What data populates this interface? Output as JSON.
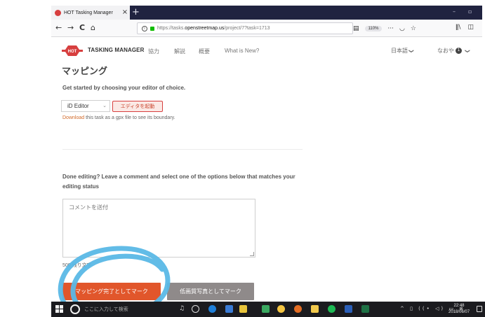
{
  "browser": {
    "tab_title": "HOT Tasking Manager",
    "tab_close": "×",
    "new_tab": "+",
    "window_minimize": "–",
    "window_restore": "▫",
    "back": "←",
    "forward": "→",
    "reload": "C",
    "home": "⌂",
    "url_prefix": "https://tasks.",
    "url_host": "openstreetmap.us",
    "url_path": "/project/7?task=1713",
    "zoom": "110%",
    "more": "···",
    "library_icon": "ǁ\\",
    "sidebar_icon": "◫"
  },
  "header": {
    "logo_badge": "HOT",
    "logo_text": "TASKING MANAGER",
    "nav": [
      "協力",
      "解説",
      "概要",
      "What is New?"
    ],
    "language": "日本語",
    "user": "なおや",
    "notifications": "1",
    "caret": "❯"
  },
  "main": {
    "section_title": "マッピング",
    "get_started": "Get started by choosing your editor of choice.",
    "editor_selected": "iD Editor",
    "editor_caret": "⌄",
    "launch_editor": "エディタを起動",
    "download_link": "Download",
    "download_rest": " this task as a gpx file to see its boundary.",
    "done_editing": "Done editing? Leave a comment and select one of the options below that matches your editing status",
    "comment_placeholder": "コメントを送付",
    "char_count": "500 残り文字",
    "mark_mapped": "マッピング完了としてマーク",
    "mark_bad_imagery": "低画質写真としてマーク"
  },
  "taskbar": {
    "search_placeholder": "ここに入力して検索",
    "tray_icons": "^ ▯ ((• ◁) ▭ ⊗",
    "time": "22:48",
    "date": "2018/06/07"
  },
  "colors": {
    "accent": "#d73f3f",
    "primary_button": "#e1562b",
    "secondary_button": "#8f8a8a",
    "highlight_scribble": "#5ab8e6",
    "tab_strip": "#202340"
  }
}
